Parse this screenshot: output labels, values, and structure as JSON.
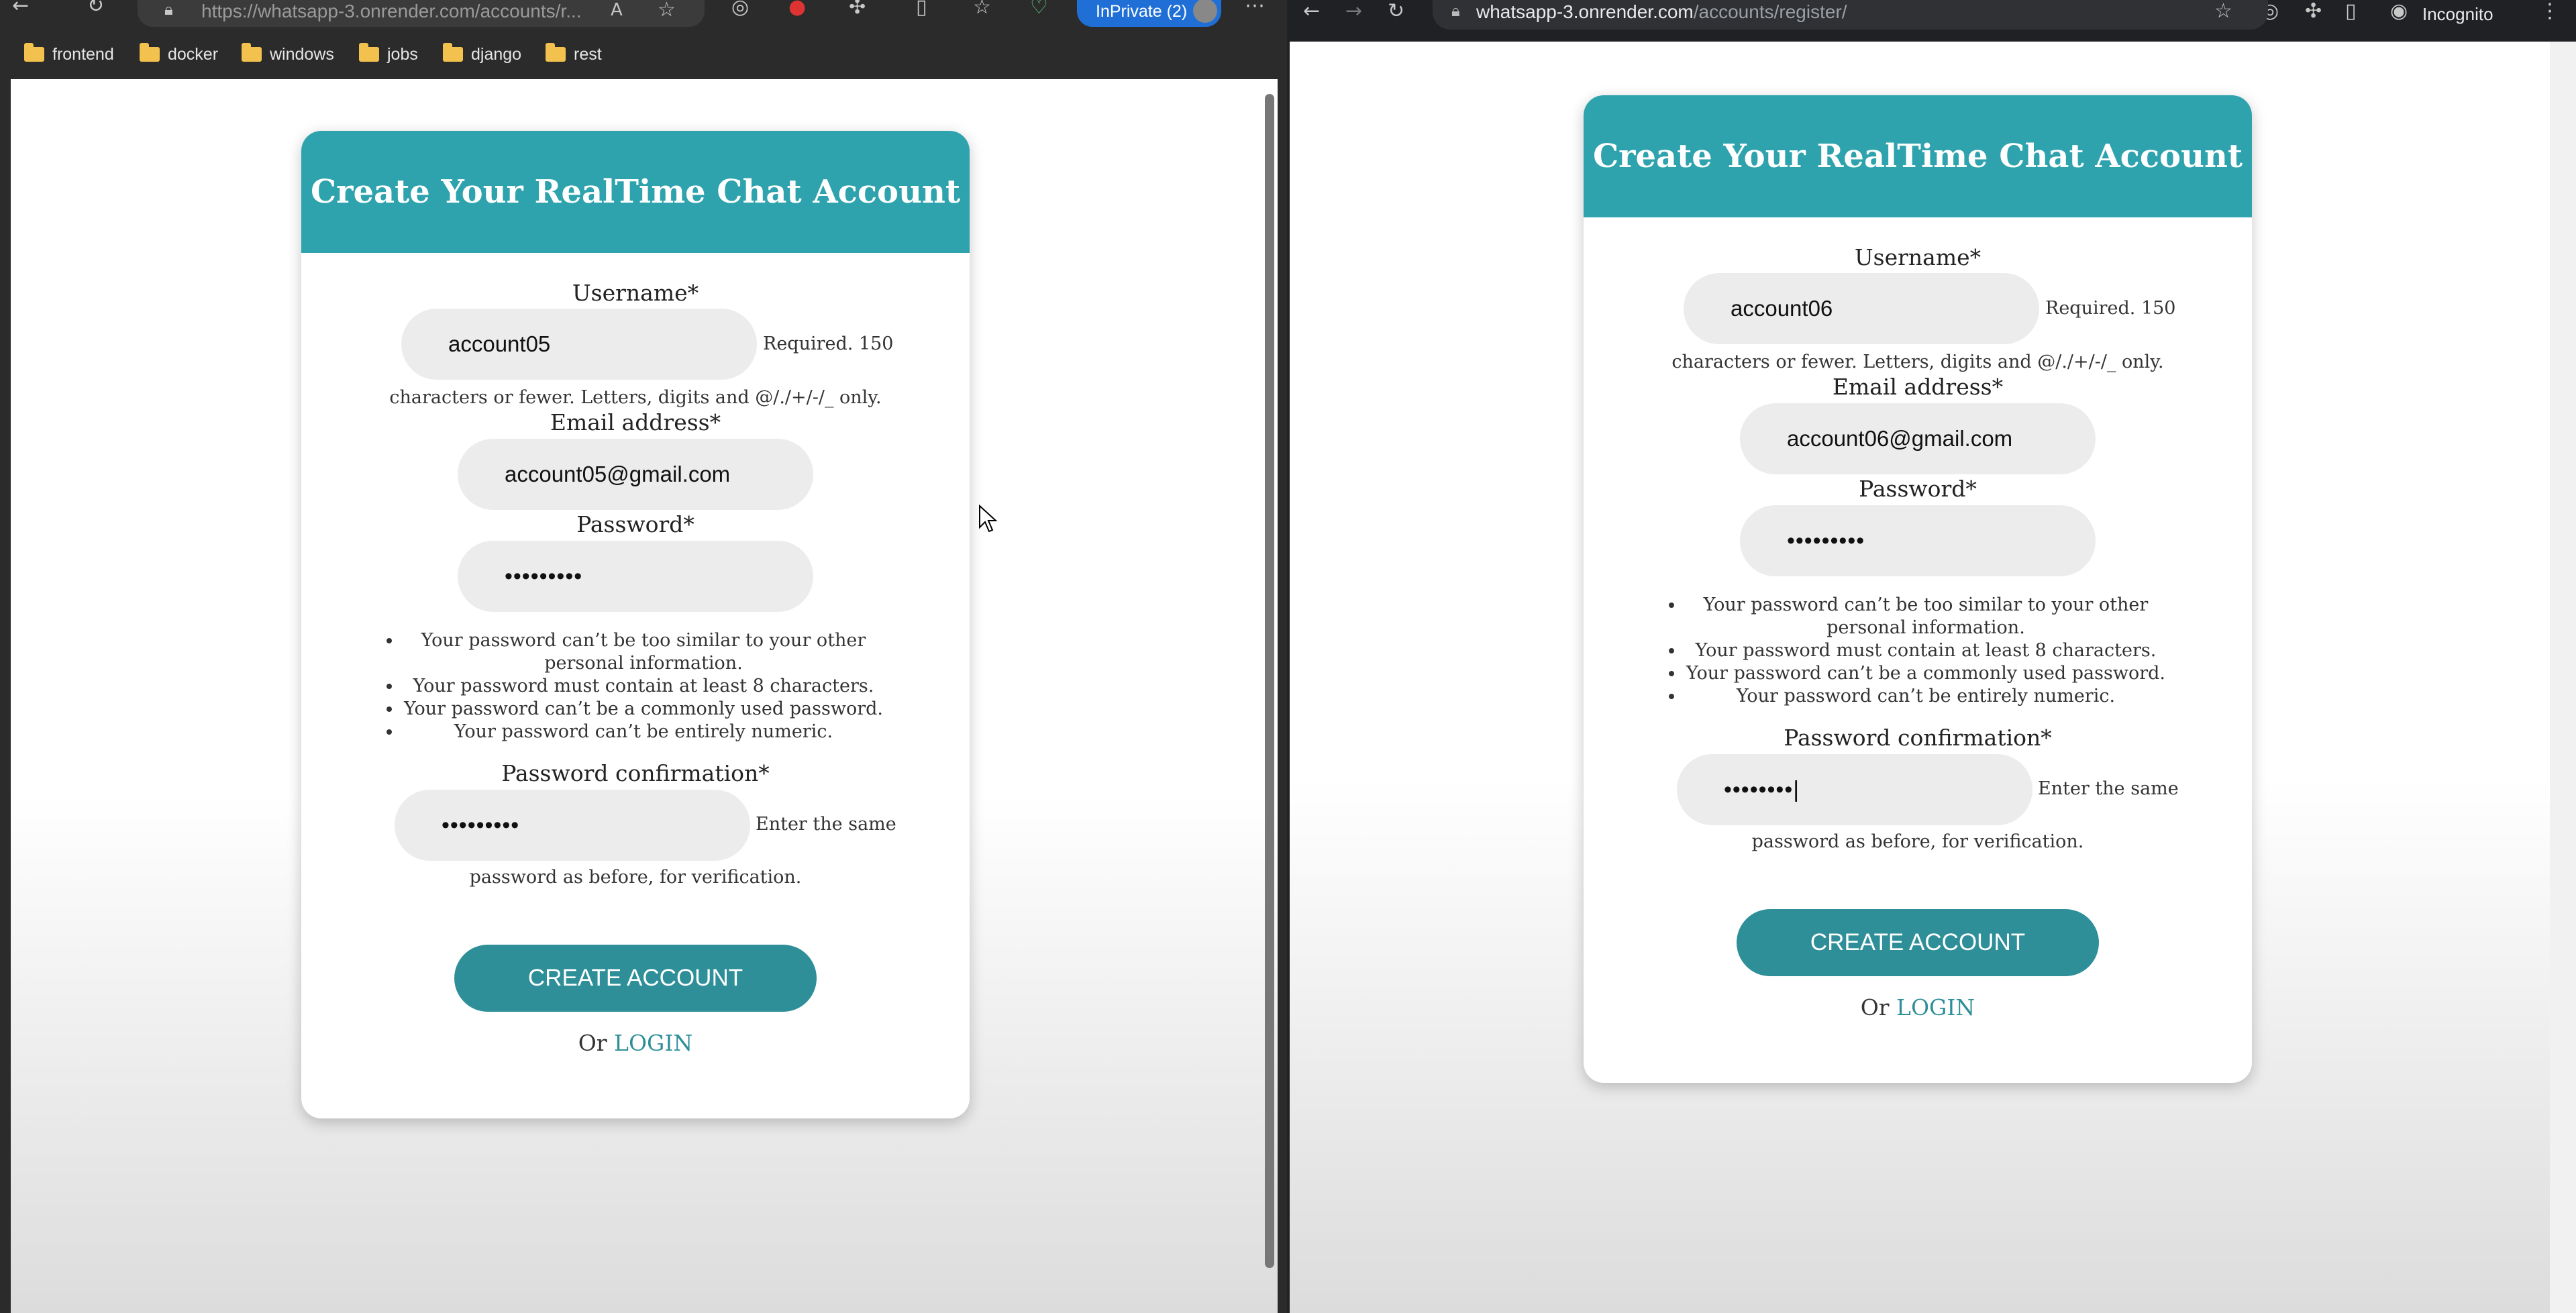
{
  "left_browser": {
    "url": "https://whatsapp-3.onrender.com/accounts/r...",
    "badge": "InPrivate (2)",
    "bookmarks": [
      "frontend",
      "docker",
      "windows",
      "jobs",
      "django",
      "rest"
    ]
  },
  "right_browser": {
    "url_host": "whatsapp-3.onrender.com",
    "url_path": "/accounts/register/",
    "mode_label": "Incognito"
  },
  "form_left": {
    "title": "Create Your RealTime Chat Account",
    "username_label": "Username*",
    "username_value": "account05",
    "username_help_a": "Required. 150",
    "username_help_b": "characters or fewer. Letters, digits and @/./+/-/_ only.",
    "email_label": "Email address*",
    "email_value": "account05@gmail.com",
    "password_label": "Password*",
    "password_value": "•••••••••",
    "rules": [
      "Your password can’t be too similar to your other personal information.",
      "Your password must contain at least 8 characters.",
      "Your password can’t be a commonly used password.",
      "Your password can’t be entirely numeric."
    ],
    "confirm_label": "Password confirmation*",
    "confirm_value": "•••••••••",
    "confirm_help_a": "Enter the same",
    "confirm_help_b": "password as before, for verification.",
    "submit_label": "CREATE ACCOUNT",
    "or_text": "Or",
    "login_label": "LOGIN"
  },
  "form_right": {
    "title": "Create Your RealTime Chat Account",
    "username_label": "Username*",
    "username_value": "account06",
    "username_help_a": "Required. 150",
    "username_help_b": "characters or fewer. Letters, digits and @/./+/-/_ only.",
    "email_label": "Email address*",
    "email_value": "account06@gmail.com",
    "password_label": "Password*",
    "password_value": "•••••••••",
    "rules": [
      "Your password can’t be too similar to your other personal information.",
      "Your password must contain at least 8 characters.",
      "Your password can’t be a commonly used password.",
      "Your password can’t be entirely numeric."
    ],
    "confirm_label": "Password confirmation*",
    "confirm_value": "••••••••|",
    "confirm_help_a": "Enter the same",
    "confirm_help_b": "password as before, for verification.",
    "submit_label": "CREATE ACCOUNT",
    "or_text": "Or",
    "login_label": "LOGIN"
  },
  "colors": {
    "header_teal": "#2ea3ad",
    "button_teal": "#2e8f99",
    "field_gray": "#ececec",
    "inprivate_blue": "#1f6fd6"
  },
  "icons": [
    "back-arrow-icon",
    "forward-arrow-icon",
    "reload-icon",
    "lock-icon",
    "star-icon",
    "extensions-icon",
    "more-icon",
    "incognito-icon",
    "folder-icon",
    "mouse-cursor-icon"
  ]
}
